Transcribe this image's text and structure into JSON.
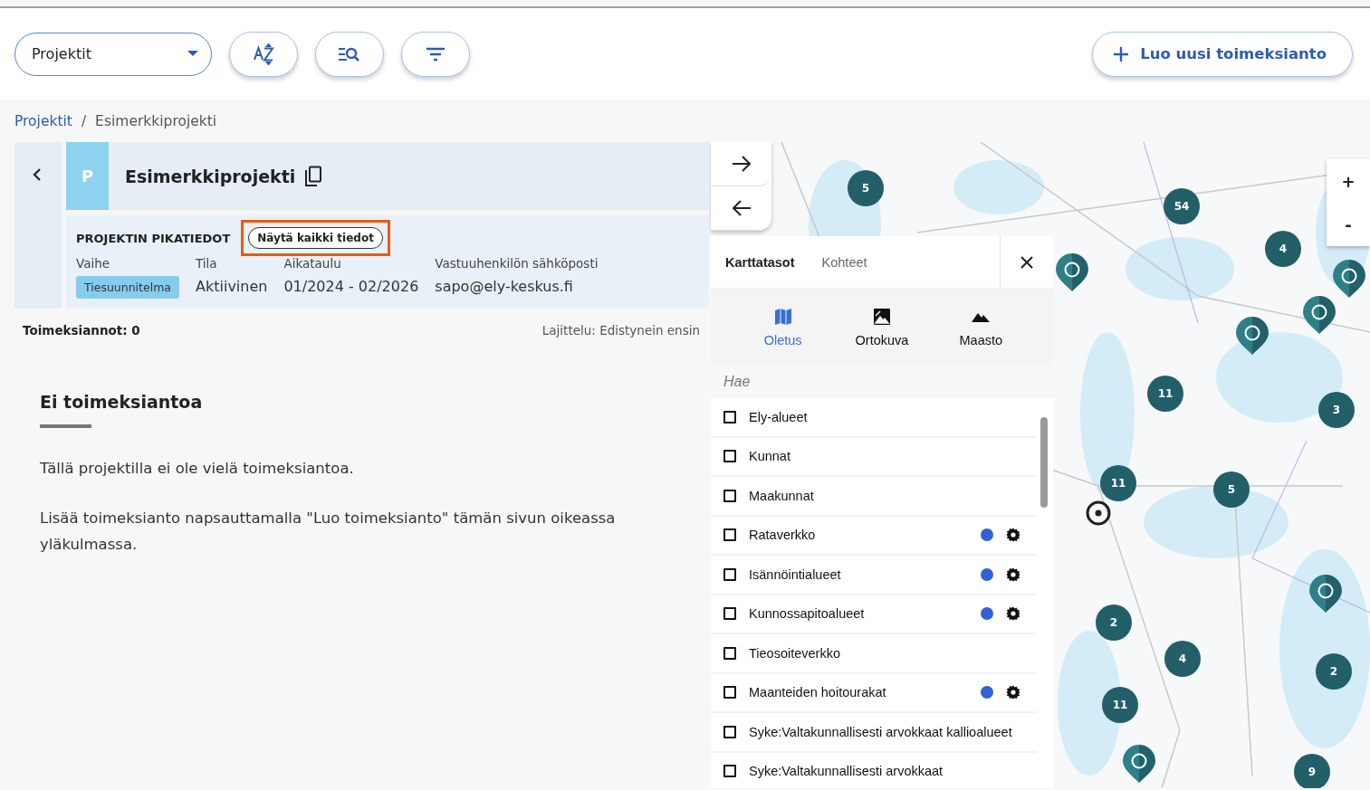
{
  "toolbar": {
    "dropdown": {
      "value": "Projektit"
    },
    "create_button": {
      "label": "Luo uusi toimeksianto"
    }
  },
  "breadcrumb": [
    {
      "label": "Projektit",
      "kind": "link"
    },
    {
      "label": "Esimerkkiprojekti",
      "kind": "current"
    }
  ],
  "breadcrumb_separator": "/",
  "project": {
    "avatar": "P",
    "title": "Esimerkkiprojekti",
    "quick_info_title": "PROJEKTIN PIKATIEDOT",
    "show_all_button": {
      "label": "Näytä kaikki tiedot",
      "highlighted": true
    },
    "fields": [
      {
        "label": "Vaihe",
        "value": "Tiesuunnitelma",
        "kind": "chip"
      },
      {
        "label": "Tila",
        "value": "Aktiivinen",
        "kind": "text"
      },
      {
        "label": "Aikataulu",
        "value": "01/2024 - 02/2026",
        "kind": "text"
      },
      {
        "label": "Vastuuhenkilön sähköposti",
        "value": "sapo@ely-keskus.fi",
        "kind": "text"
      }
    ]
  },
  "assignments": {
    "count": "Toimeksiannot: 0",
    "sort": "Lajittelu: Edistynein ensin",
    "empty_title": "Ei toimeksiantoa",
    "empty_paragraphs": [
      "Tällä projektilla ei ole vielä toimeksiantoa.",
      "Lisää toimeksianto napsauttamalla \"Luo toimeksianto\" tämän sivun oikeassa yläkulmassa."
    ]
  },
  "map": {
    "zoom_in": "+",
    "zoom_out": "-",
    "clusters": [
      {
        "count": "5"
      },
      {
        "count": "54"
      },
      {
        "count": "4"
      },
      {
        "count": "11"
      },
      {
        "count": "3"
      },
      {
        "count": "11"
      },
      {
        "count": "5"
      },
      {
        "count": "2"
      },
      {
        "count": "4"
      },
      {
        "count": "2"
      },
      {
        "count": "11"
      },
      {
        "count": "9"
      }
    ],
    "layer_panel": {
      "tabs": [
        {
          "label": "Karttatasot",
          "selected": true
        },
        {
          "label": "Kohteet",
          "selected": false
        }
      ],
      "basemaps": [
        {
          "label": "Oletus",
          "kind": "map",
          "selected": true
        },
        {
          "label": "Ortokuva",
          "kind": "photo",
          "selected": false
        },
        {
          "label": "Maasto",
          "kind": "terrain",
          "selected": false
        }
      ],
      "search": {
        "placeholder": "Hae"
      },
      "layers": [
        {
          "label": "Ely-alueet",
          "checked": false,
          "kind": "plain"
        },
        {
          "label": "Kunnat",
          "checked": false,
          "kind": "plain"
        },
        {
          "label": "Maakunnat",
          "checked": false,
          "kind": "plain"
        },
        {
          "label": "Rataverkko",
          "checked": false,
          "kind": "styled",
          "color": "#3561d6"
        },
        {
          "label": "Isännöintialueet",
          "checked": false,
          "kind": "styled",
          "color": "#3561d6"
        },
        {
          "label": "Kunnossapitoalueet",
          "checked": false,
          "kind": "styled",
          "color": "#3561d6"
        },
        {
          "label": "Tieosoiteverkko",
          "checked": false,
          "kind": "plain"
        },
        {
          "label": "Maanteiden hoitourakat",
          "checked": false,
          "kind": "styled",
          "color": "#3561d6"
        },
        {
          "label": "Syke:Valtakunnallisesti arvokkaat kallioalueet",
          "checked": false,
          "kind": "plain"
        },
        {
          "label": "Syke:Valtakunnallisesti arvokkaat",
          "checked": false,
          "kind": "plain"
        }
      ]
    }
  }
}
